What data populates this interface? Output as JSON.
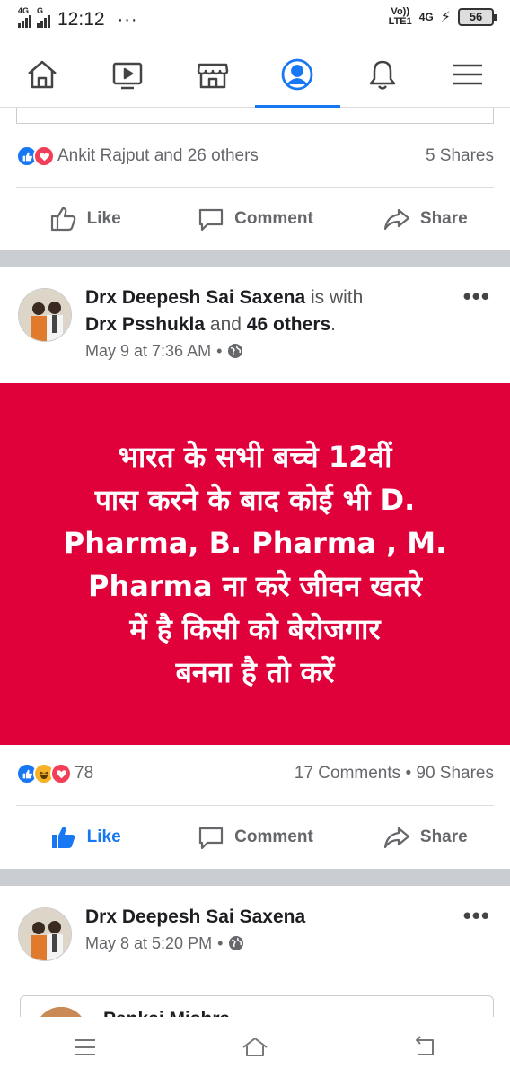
{
  "status_bar": {
    "net1": "4G",
    "net2": "G",
    "time": "12:12",
    "dots": "···",
    "volte_top": "Vo))",
    "volte_bottom": "LTE1",
    "net3": "4G",
    "battery": "56"
  },
  "nav": {
    "tabs": [
      {
        "icon": "home-icon",
        "active": false
      },
      {
        "icon": "video-icon",
        "active": false
      },
      {
        "icon": "marketplace-icon",
        "active": false
      },
      {
        "icon": "profile-icon",
        "active": true
      },
      {
        "icon": "bell-icon",
        "active": false
      },
      {
        "icon": "menu-icon",
        "active": false
      }
    ]
  },
  "post1": {
    "reactions_text": "Ankit Rajput and 26 others",
    "shares": "5 Shares",
    "like_label": "Like",
    "comment_label": "Comment",
    "share_label": "Share"
  },
  "post2": {
    "author": "Drx Deepesh Sai Saxena",
    "with_text": " is with",
    "tagged": "Drx Psshukla",
    "and_text": " and ",
    "others": "46 others",
    "period": ".",
    "timestamp": "May 9 at 7:36 AM",
    "sep": "•",
    "banner_line1": "भारत के सभी बच्चे 12वीं",
    "banner_line2": "पास करने के बाद कोई भी D.",
    "banner_line3": "Pharma, B. Pharma , M.",
    "banner_line4": "Pharma ना करे जीवन खतरे",
    "banner_line5": "में है किसी को बेरोजगार",
    "banner_line6": "बनना है तो करें",
    "reaction_count": "78",
    "comments": "17 Comments",
    "dot": "•",
    "shares": "90 Shares",
    "like_label": "Like",
    "comment_label": "Comment",
    "share_label": "Share"
  },
  "post3": {
    "author": "Drx Deepesh Sai Saxena",
    "timestamp": "May 8 at 5:20 PM",
    "sep": "•",
    "shared_name": "Pankaj Mishra"
  },
  "more_dots": "•••",
  "colors": {
    "brand_blue": "#1877f2",
    "banner_red": "#e0003a",
    "love_red": "#f33e58",
    "muted_text": "#65676b"
  }
}
